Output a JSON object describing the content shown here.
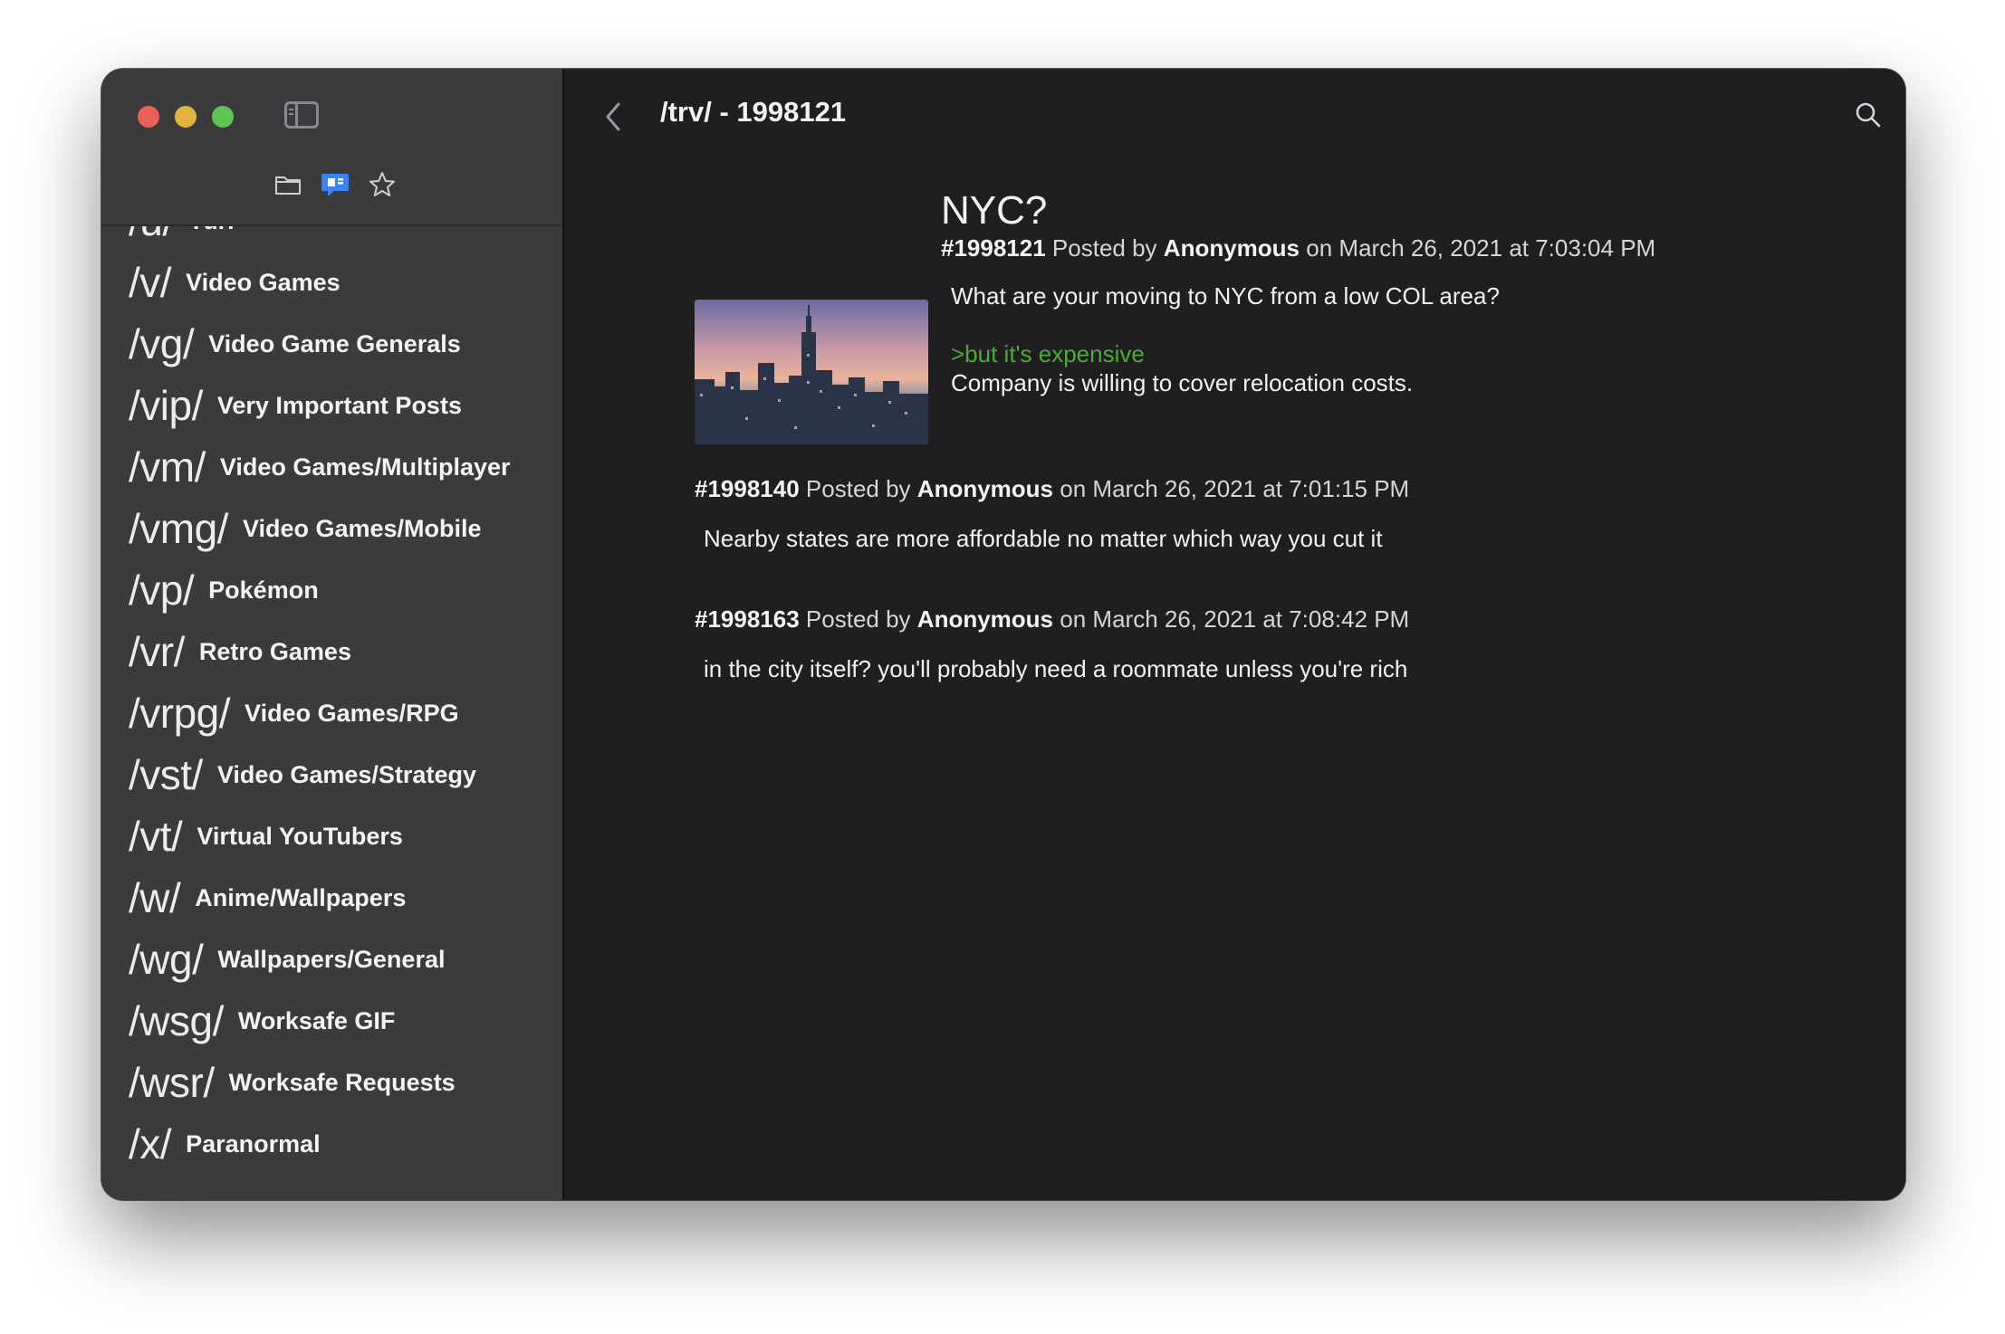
{
  "window": {
    "controls": [
      "close",
      "minimize",
      "zoom"
    ]
  },
  "sidebar": {
    "toggle_icon": "sidebar-toggle-icon",
    "tabs": [
      {
        "icon": "folder-icon",
        "active": false
      },
      {
        "icon": "speech-bubble-icon",
        "active": true
      },
      {
        "icon": "star-icon",
        "active": false
      }
    ],
    "partial_item": {
      "code": "/u/",
      "name": "Yuri"
    },
    "boards": [
      {
        "code": "/v/",
        "name": "Video Games"
      },
      {
        "code": "/vg/",
        "name": "Video Game Generals"
      },
      {
        "code": "/vip/",
        "name": "Very Important Posts"
      },
      {
        "code": "/vm/",
        "name": "Video Games/Multiplayer"
      },
      {
        "code": "/vmg/",
        "name": "Video Games/Mobile"
      },
      {
        "code": "/vp/",
        "name": "Pokémon"
      },
      {
        "code": "/vr/",
        "name": "Retro Games"
      },
      {
        "code": "/vrpg/",
        "name": "Video Games/RPG"
      },
      {
        "code": "/vst/",
        "name": "Video Games/Strategy"
      },
      {
        "code": "/vt/",
        "name": "Virtual YouTubers"
      },
      {
        "code": "/w/",
        "name": "Anime/Wallpapers"
      },
      {
        "code": "/wg/",
        "name": "Wallpapers/General"
      },
      {
        "code": "/wsg/",
        "name": "Worksafe GIF"
      },
      {
        "code": "/wsr/",
        "name": "Worksafe Requests"
      },
      {
        "code": "/x/",
        "name": "Paranormal"
      }
    ]
  },
  "toolbar": {
    "title": "/trv/ - 1998121",
    "back_icon": "chevron-left-icon",
    "search_icon": "magnifier-icon"
  },
  "op": {
    "subject": "NYC?",
    "number": "#1998121",
    "posted_by": "Posted by",
    "author": "Anonymous",
    "on": "on",
    "date": "March 26, 2021 at 7:03:04 PM",
    "body_line1": "What are your moving to NYC from a low COL area?",
    "greentext": ">but it's expensive",
    "body_line2": "Company is willing to cover relocation costs.",
    "image_icon": "city-skyline-thumbnail"
  },
  "replies": [
    {
      "number": "#1998140",
      "posted_by": "Posted by",
      "author": "Anonymous",
      "on": "on",
      "date": "March 26, 2021 at 7:01:15 PM",
      "body": "Nearby states are more affordable no matter which way you cut it"
    },
    {
      "number": "#1998163",
      "posted_by": "Posted by",
      "author": "Anonymous",
      "on": "on",
      "date": "March 26, 2021 at 7:08:42 PM",
      "body": "in the city itself? you'll probably need a roommate unless you're rich"
    }
  ],
  "colors": {
    "close": "#ec5f57",
    "minimize": "#e2b33c",
    "zoom": "#5fc453",
    "accent": "#3b82f6",
    "greentext": "#4fa83a",
    "sidebar_bg": "#3b3b3e",
    "main_bg": "#1f1f21"
  }
}
